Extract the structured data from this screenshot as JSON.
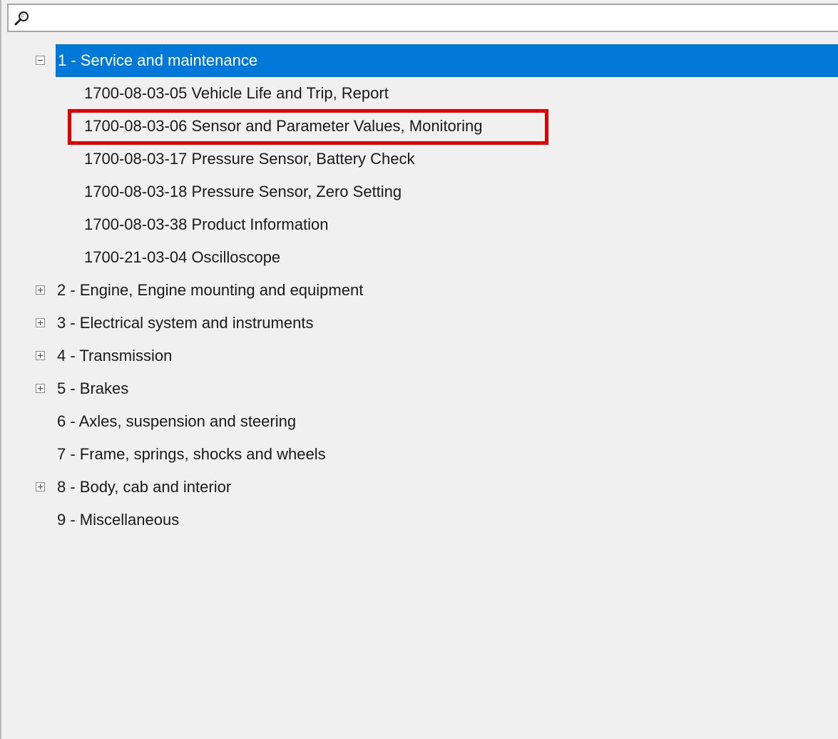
{
  "search": {
    "value": "",
    "placeholder": "",
    "icon": "search-icon"
  },
  "colors": {
    "selection": "#0078d7",
    "highlight": "#e10000",
    "background": "#f0f0f0"
  },
  "tree": {
    "items": [
      {
        "label": "1 - Service and maintenance",
        "expanded": true,
        "selected": true
      },
      {
        "label": "1700-08-03-05 Vehicle Life and Trip, Report"
      },
      {
        "label": "1700-08-03-06 Sensor and Parameter Values, Monitoring",
        "highlighted": true
      },
      {
        "label": "1700-08-03-17 Pressure Sensor, Battery Check"
      },
      {
        "label": "1700-08-03-18 Pressure Sensor, Zero Setting"
      },
      {
        "label": "1700-08-03-38 Product Information"
      },
      {
        "label": "1700-21-03-04 Oscilloscope"
      },
      {
        "label": "2 - Engine, Engine mounting and equipment",
        "expandable": true
      },
      {
        "label": "3 - Electrical system and instruments",
        "expandable": true
      },
      {
        "label": "4 - Transmission",
        "expandable": true
      },
      {
        "label": "5 - Brakes",
        "expandable": true
      },
      {
        "label": "6 - Axles, suspension and steering"
      },
      {
        "label": "7 - Frame, springs, shocks and wheels"
      },
      {
        "label": "8 - Body, cab and interior",
        "expandable": true
      },
      {
        "label": "9 - Miscellaneous"
      }
    ]
  }
}
